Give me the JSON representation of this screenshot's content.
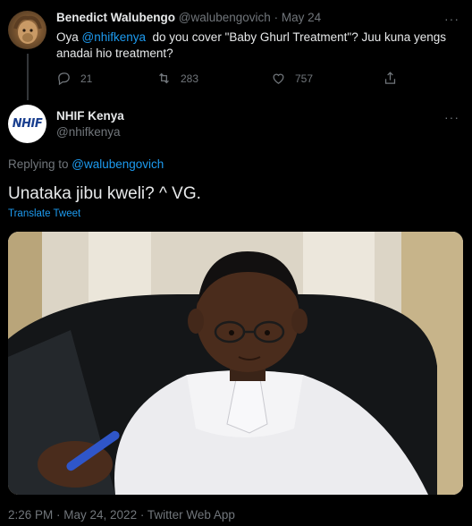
{
  "tweet1": {
    "display_name": "Benedict Walubengo",
    "handle": "@walubengovich",
    "separator": "·",
    "date": "May 24",
    "text_prefix": "Oya ",
    "mention": "@nhifkenya",
    "text_line1_rest": "  do you cover \"Baby Ghurl Treatment\"? Juu kuna yengs",
    "text_line2": "anadai hio treatment?",
    "more": "···",
    "replies": "21",
    "retweets": "283",
    "likes": "757"
  },
  "tweet2": {
    "display_name": "NHIF Kenya",
    "handle": "@nhifkenya",
    "avatar_text": "NHIF",
    "more": "···",
    "replying_prefix": "Replying to ",
    "replying_to": "@walubengovich",
    "text": "Unataka jibu kweli? ^ VG.",
    "translate": "Translate Tweet",
    "timestamp": "2:26 PM · May 24, 2022 · Twitter Web App"
  },
  "colors": {
    "background": "#000000",
    "text": "#e7e9ea",
    "muted": "#71767b",
    "link": "#1d9bf0"
  },
  "icons": [
    "reply-icon",
    "retweet-icon",
    "like-icon",
    "share-icon",
    "more-icon"
  ]
}
